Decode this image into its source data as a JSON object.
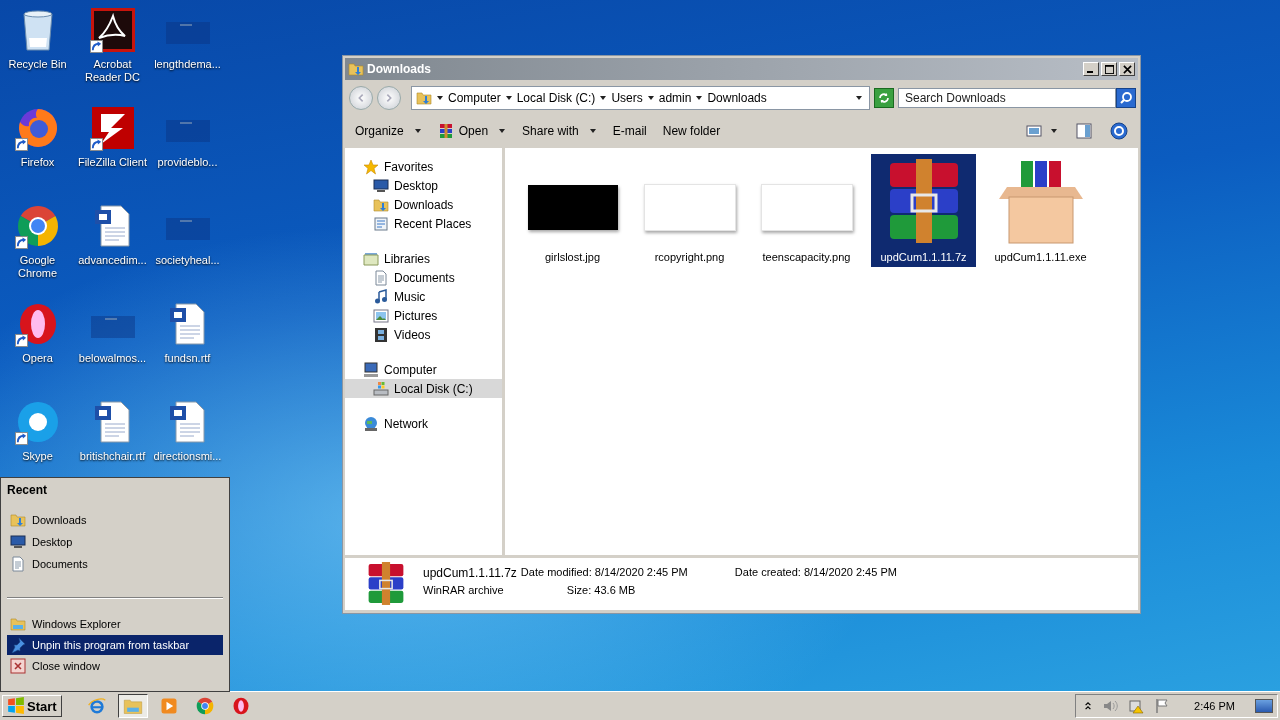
{
  "desktop": {
    "icons": [
      {
        "label": "Recycle Bin",
        "kind": "recycle",
        "shortcut": false
      },
      {
        "label": "Firefox",
        "kind": "firefox",
        "shortcut": true
      },
      {
        "label": "Google Chrome",
        "kind": "chrome",
        "shortcut": true
      },
      {
        "label": "Opera",
        "kind": "opera",
        "shortcut": true
      },
      {
        "label": "Skype",
        "kind": "skype",
        "shortcut": true
      },
      {
        "label": "Acrobat Reader DC",
        "kind": "acrobat",
        "shortcut": true
      },
      {
        "label": "FileZilla Client",
        "kind": "filezilla",
        "shortcut": true
      },
      {
        "label": "advancedim...",
        "kind": "word",
        "shortcut": false
      },
      {
        "label": "belowalmos...",
        "kind": "blank",
        "shortcut": false
      },
      {
        "label": "britishchair.rtf",
        "kind": "word",
        "shortcut": false
      },
      {
        "label": "lengthdema...",
        "kind": "blank",
        "shortcut": false
      },
      {
        "label": "provideblo...",
        "kind": "blank",
        "shortcut": false
      },
      {
        "label": "societyheal...",
        "kind": "blank",
        "shortcut": false
      },
      {
        "label": "fundsn.rtf",
        "kind": "word",
        "shortcut": false
      },
      {
        "label": "directionsmi...",
        "kind": "word",
        "shortcut": false
      }
    ]
  },
  "window": {
    "title": "Downloads",
    "address": [
      "Computer",
      "Local Disk (C:)",
      "Users",
      "admin",
      "Downloads"
    ],
    "search": {
      "placeholder": "Search Downloads"
    },
    "toolbar": [
      {
        "label": "Organize",
        "kind": "plain",
        "dropdown": true
      },
      {
        "label": "Open",
        "kind": "archive",
        "dropdown": true
      },
      {
        "label": "Share with",
        "kind": "plain",
        "dropdown": true
      },
      {
        "label": "E-mail",
        "kind": "plain",
        "dropdown": false
      },
      {
        "label": "New folder",
        "kind": "plain",
        "dropdown": false
      }
    ],
    "nav": [
      {
        "label": "Favorites",
        "kind": "star",
        "selected": false,
        "children": [
          {
            "label": "Desktop",
            "kind": "desktop",
            "selected": false
          },
          {
            "label": "Downloads",
            "kind": "downloads",
            "selected": false
          },
          {
            "label": "Recent Places",
            "kind": "recent",
            "selected": false
          }
        ]
      },
      {
        "label": "Libraries",
        "kind": "library",
        "selected": false,
        "children": [
          {
            "label": "Documents",
            "kind": "doc",
            "selected": false
          },
          {
            "label": "Music",
            "kind": "music",
            "selected": false
          },
          {
            "label": "Pictures",
            "kind": "pictures",
            "selected": false
          },
          {
            "label": "Videos",
            "kind": "film",
            "selected": false
          }
        ]
      },
      {
        "label": "Computer",
        "kind": "computer",
        "selected": false,
        "children": [
          {
            "label": "Local Disk (C:)",
            "kind": "drive",
            "selected": true
          }
        ]
      },
      {
        "label": "Network",
        "kind": "network",
        "selected": false
      }
    ],
    "files": [
      {
        "name": "girlslost.jpg",
        "kind": "dark-image",
        "selected": false
      },
      {
        "name": "rcopyright.png",
        "kind": "light-image",
        "selected": false
      },
      {
        "name": "teenscapacity.png",
        "kind": "light-image",
        "selected": false
      },
      {
        "name": "updCum1.1.11.7z",
        "kind": "archive",
        "selected": true
      },
      {
        "name": "updCum1.1.11.exe",
        "kind": "installer",
        "selected": false
      }
    ],
    "details": {
      "kind": "archive",
      "name": "updCum1.1.11.7z",
      "type": "WinRAR archive",
      "modified": "Date modified: 8/14/2020 2:45 PM",
      "size": "Size: 43.6 MB",
      "created": "Date created: 8/14/2020 2:45 PM"
    }
  },
  "jump_list": {
    "title": "Recent",
    "recent": [
      {
        "label": "Downloads",
        "kind": "downloads"
      },
      {
        "label": "Desktop",
        "kind": "desktop"
      },
      {
        "label": "Documents",
        "kind": "doc"
      }
    ],
    "tasks": [
      {
        "label": "Windows Explorer",
        "kind": "explorer",
        "selected": false
      },
      {
        "label": "Unpin this program from taskbar",
        "kind": "pin",
        "selected": true
      },
      {
        "label": "Close window",
        "kind": "close",
        "selected": false
      }
    ]
  },
  "taskbar": {
    "start": "Start",
    "apps": [
      {
        "kind": "ie",
        "selected": false
      },
      {
        "kind": "explorer",
        "selected": true
      },
      {
        "kind": "media",
        "selected": false
      },
      {
        "kind": "chrome",
        "selected": false
      },
      {
        "kind": "opera",
        "selected": false
      }
    ],
    "clock": "2:46 PM"
  }
}
